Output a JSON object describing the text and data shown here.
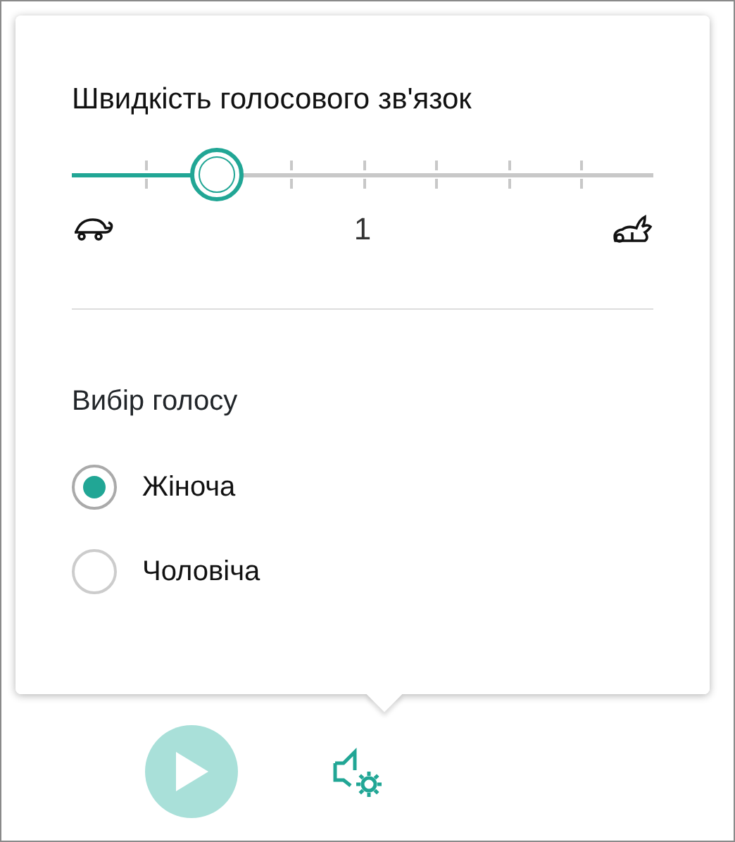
{
  "speed": {
    "title": "Швидкість голосового зв'язок",
    "level": 0.25,
    "reading": "1"
  },
  "voice": {
    "title": "Вибір голосу",
    "options": [
      {
        "label": "Жіноча",
        "selected": true
      },
      {
        "label": "Чоловіча",
        "selected": false
      }
    ]
  },
  "play_button": {
    "disabled": true
  }
}
